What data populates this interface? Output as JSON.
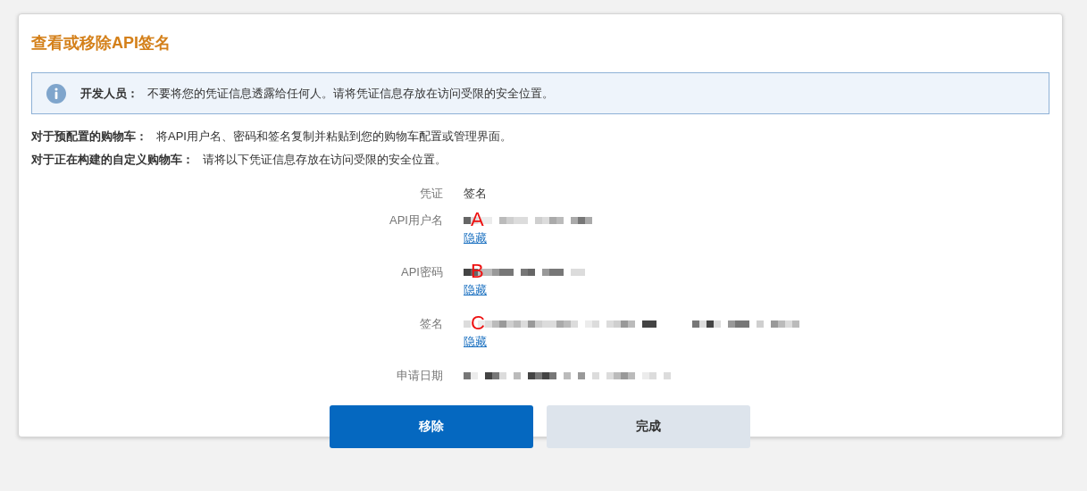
{
  "dialog": {
    "title": "查看或移除API签名",
    "notice": {
      "label": "开发人员：",
      "text": "不要将您的凭证信息透露给任何人。请将凭证信息存放在访问受限的安全位置。"
    },
    "instructions": [
      {
        "label": "对于预配置的购物车：",
        "text": "将API用户名、密码和签名复制并粘贴到您的购物车配置或管理界面。"
      },
      {
        "label": "对于正在构建的自定义购物车：",
        "text": "请将以下凭证信息存放在访问受限的安全位置。"
      }
    ],
    "fields": [
      {
        "label": "凭证",
        "kind": "text",
        "value": "签名"
      },
      {
        "label": "API用户名",
        "kind": "redacted",
        "annotation": "A",
        "link": "隐藏"
      },
      {
        "label": "API密码",
        "kind": "redacted",
        "annotation": "B",
        "link": "隐藏"
      },
      {
        "label": "签名",
        "kind": "redacted",
        "annotation": "C",
        "link": "隐藏"
      },
      {
        "label": "申请日期",
        "kind": "redacted"
      }
    ],
    "buttons": [
      {
        "label": "移除",
        "kind": "primary"
      },
      {
        "label": "完成",
        "kind": "secondary"
      }
    ]
  }
}
